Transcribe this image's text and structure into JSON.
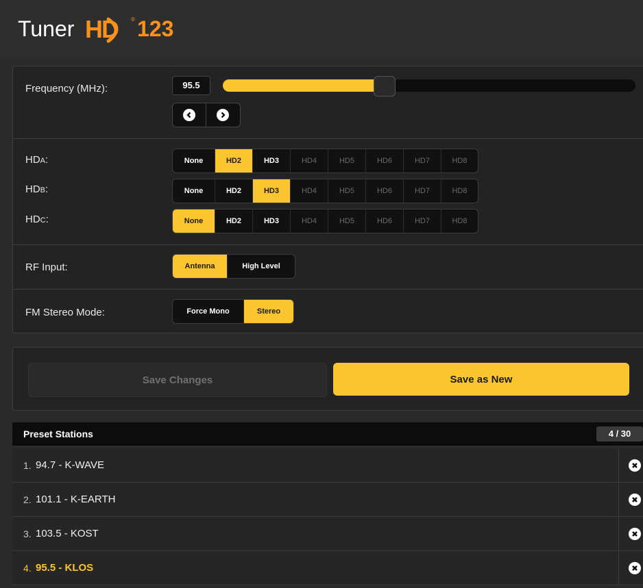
{
  "header": {
    "title_word": "Tuner",
    "logo_hd": "HD",
    "logo_number": "123",
    "logo_reg": "®"
  },
  "frequency": {
    "label": "Frequency (MHz):",
    "value": "95.5",
    "slider_fraction": 0.39,
    "prev_icon": "chevron-left-icon",
    "next_icon": "chevron-right-icon"
  },
  "hd_channels": [
    {
      "label_main": "HD",
      "label_sub": "A",
      "selected": "HD2"
    },
    {
      "label_main": "HD",
      "label_sub": "B",
      "selected": "HD3"
    },
    {
      "label_main": "HD",
      "label_sub": "C",
      "selected": "None"
    }
  ],
  "hd_options": [
    "None",
    "HD2",
    "HD3",
    "HD4",
    "HD5",
    "HD6",
    "HD7",
    "HD8"
  ],
  "hd_disabled": [
    "HD4",
    "HD5",
    "HD6",
    "HD7",
    "HD8"
  ],
  "rf_input": {
    "label": "RF Input:",
    "options": [
      "Antenna",
      "High Level"
    ],
    "selected": "Antenna"
  },
  "fm_stereo": {
    "label": "FM Stereo Mode:",
    "options": [
      "Force Mono",
      "Stereo"
    ],
    "selected": "Stereo"
  },
  "actions": {
    "save_changes": "Save Changes",
    "save_as_new": "Save as New"
  },
  "presets": {
    "title": "Preset Stations",
    "count": "4 / 30",
    "items": [
      {
        "num": "1.",
        "name": "94.7 - K-WAVE",
        "active": false
      },
      {
        "num": "2.",
        "name": "101.1 - K-EARTH",
        "active": false
      },
      {
        "num": "3.",
        "name": "103.5 - KOST",
        "active": false
      },
      {
        "num": "4.",
        "name": "95.5 - KLOS",
        "active": true
      }
    ],
    "delete_icon": "close-icon"
  },
  "colors": {
    "accent": "#fbc530",
    "brand_orange": "#f7921e",
    "background": "#2b2b2b"
  }
}
